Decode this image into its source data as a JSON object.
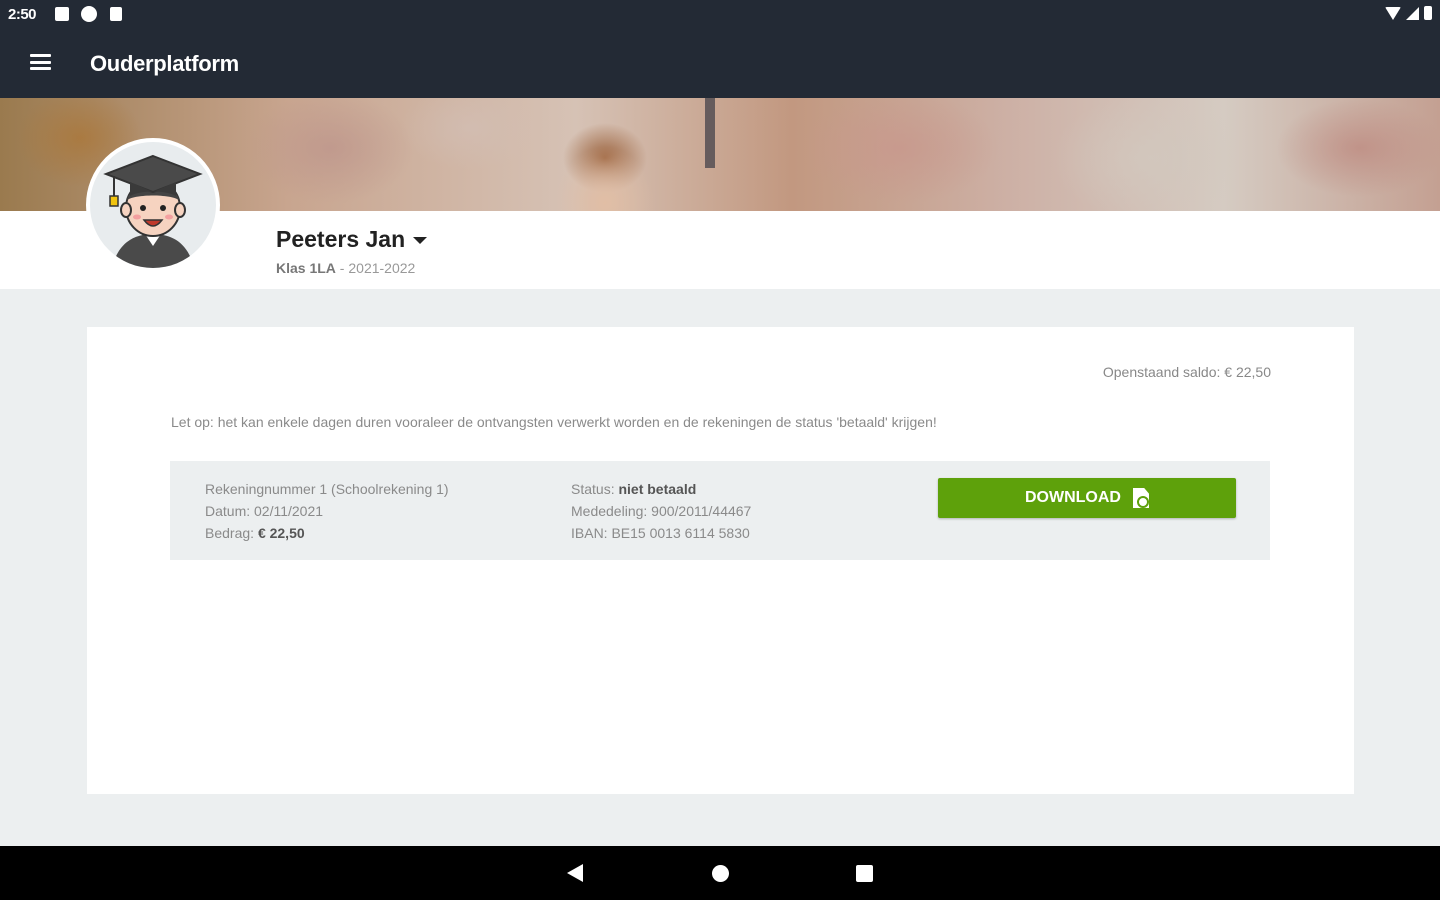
{
  "status_bar": {
    "time": "2:50",
    "left_icons": [
      "notification-icon",
      "notification-icon",
      "parking-icon",
      "sd-card-icon"
    ],
    "right_icons": [
      "wifi-icon",
      "signal-icon",
      "battery-icon"
    ]
  },
  "app_bar": {
    "title": "Ouderplatform",
    "menu_icon": "hamburger-icon"
  },
  "profile": {
    "name": "Peeters Jan",
    "class_label": "Klas 1LA",
    "separator": " - ",
    "school_year": "2021-2022",
    "avatar_icon": "graduate-avatar-icon"
  },
  "finance": {
    "balance": "Openstaand saldo: € 22,50",
    "notice": "Let op: het kan enkele dagen duren vooraleer de ontvangsten verwerkt worden en de rekeningen de status 'betaald' krijgen!",
    "invoice": {
      "title": "Rekeningnummer 1 (Schoolrekening 1)",
      "date_label": "Datum: ",
      "date": "02/11/2021",
      "amount_label": "Bedrag: ",
      "amount": "€ 22,50",
      "status_label": "Status: ",
      "status": "niet betaald",
      "reference_label": "Mededeling: ",
      "reference": "900/2011/44467",
      "iban_label": "IBAN: ",
      "iban": "BE15 0013 6114 5830",
      "download_label": "DOWNLOAD",
      "download_icon": "pdf-file-icon"
    }
  },
  "colors": {
    "appbar": "#232a35",
    "accent_green": "#5ea10b",
    "page_bg": "#eceff0"
  },
  "nav_bar": {
    "icons": [
      "back-icon",
      "home-icon",
      "recents-icon"
    ]
  }
}
